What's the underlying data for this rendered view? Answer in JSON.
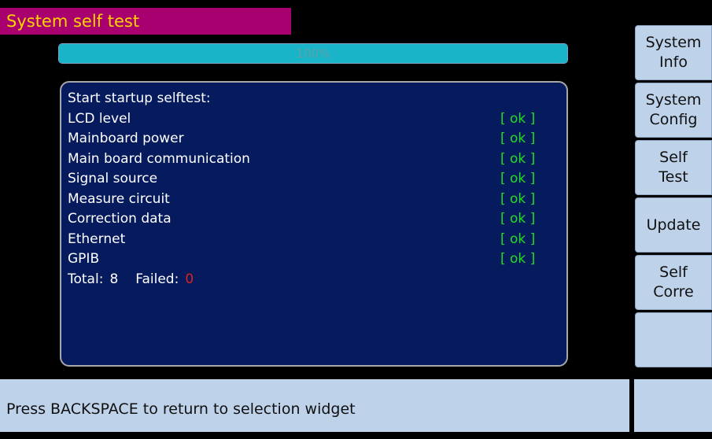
{
  "header": {
    "title": "System self test"
  },
  "progress": {
    "value_percent": 100,
    "label": "100%"
  },
  "selftest": {
    "intro": "Start startup selftest:",
    "items": [
      {
        "name": "LCD level",
        "status": "[ ok ]"
      },
      {
        "name": "Mainboard power",
        "status": "[ ok ]"
      },
      {
        "name": "Main board communication",
        "status": "[ ok ]"
      },
      {
        "name": "Signal source",
        "status": "[ ok ]"
      },
      {
        "name": "Measure circuit",
        "status": "[ ok ]"
      },
      {
        "name": "Correction data",
        "status": "[ ok ]"
      },
      {
        "name": "Ethernet",
        "status": "[ ok ]"
      },
      {
        "name": "GPIB",
        "status": "[ ok ]"
      }
    ],
    "summary": {
      "total_label": "Total:",
      "total_value": "8",
      "failed_label": "Failed:",
      "failed_value": "0"
    }
  },
  "softkeys": [
    {
      "line1": "System",
      "line2": "Info"
    },
    {
      "line1": "System",
      "line2": "Config"
    },
    {
      "line1": "Self",
      "line2": "Test"
    },
    {
      "line1": "Update",
      "line2": ""
    },
    {
      "line1": "Self",
      "line2": "Corre"
    },
    {
      "line1": "",
      "line2": ""
    }
  ],
  "status_bar": {
    "message": "Press BACKSPACE to return to selection widget"
  },
  "colors": {
    "title_bg": "#a8006e",
    "title_text": "#ffd400",
    "panel_bg": "#061a5e",
    "ok_text": "#22dd22",
    "failed_text": "#e02020",
    "progress_fill": "#19b4c8",
    "softkey_bg": "#bed2ea"
  }
}
